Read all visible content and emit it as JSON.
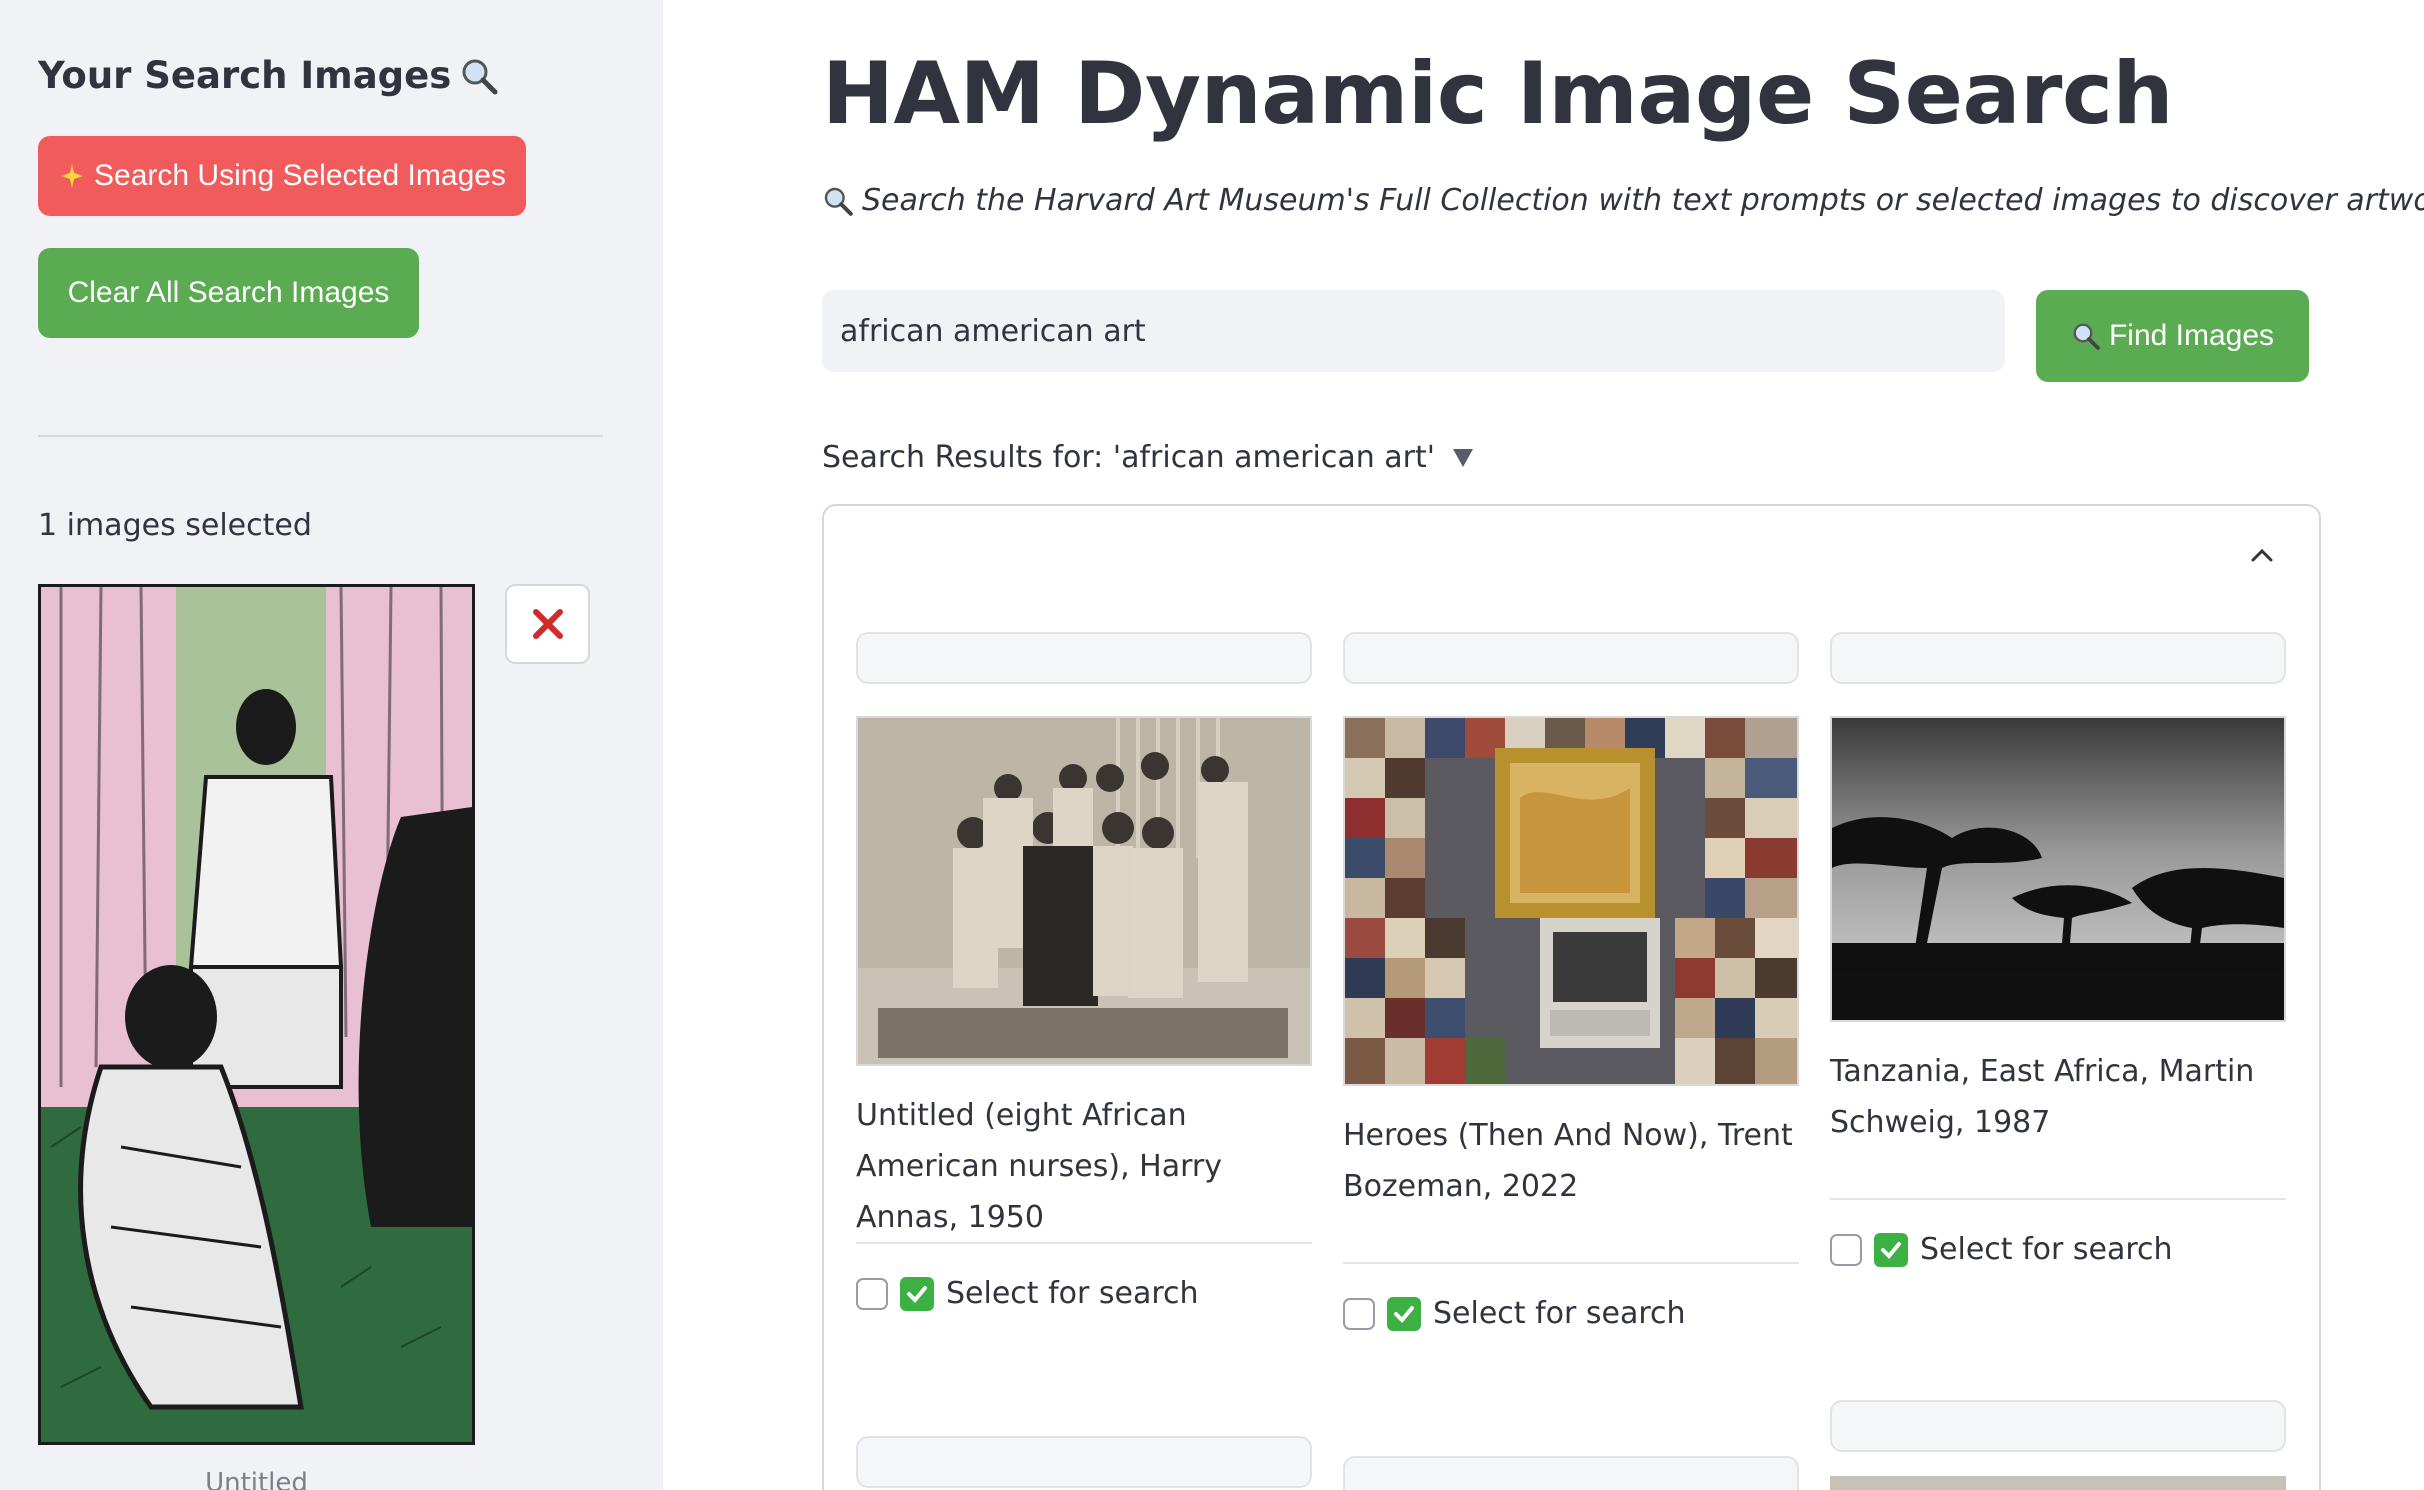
{
  "sidebar": {
    "title": "Your Search Images",
    "title_icon": "magnifier-icon",
    "search_selected_label": "Search Using Selected Images",
    "search_selected_icon": "sparkles-icon",
    "clear_label": "Clear All Search Images",
    "selected_count_text": "1 images selected",
    "selected_image_caption": "Untitled",
    "remove_icon": "red-x-icon"
  },
  "main": {
    "title": "HAM Dynamic Image Search",
    "subtitle": "Search the Harvard Art Museum's Full Collection with text prompts or selected images to discover artworks",
    "subtitle_icon": "magnifier-icon",
    "search": {
      "value": "african american art",
      "button_label": "Find Images",
      "button_icon": "magnifier-icon"
    },
    "results_label": "Search Results for: 'african american art'",
    "results_toggle_icon": "triangle-down-icon",
    "collapse_icon": "chevron-up-icon",
    "results": [
      {
        "caption": "Untitled (eight African American nurses), Harry Annas, 1950",
        "select_label": "Select for search",
        "selected": false
      },
      {
        "caption": "Heroes (Then And Now), Trent Bozeman, 2022",
        "select_label": "Select for search",
        "selected": false
      },
      {
        "caption": "Tanzania, East Africa, Martin Schweig, 1987",
        "select_label": "Select for search",
        "selected": false
      }
    ]
  },
  "colors": {
    "primary_red": "#f15b5b",
    "green": "#5aab52",
    "sidebar_bg": "#f0f2f6",
    "text": "#31333f"
  }
}
